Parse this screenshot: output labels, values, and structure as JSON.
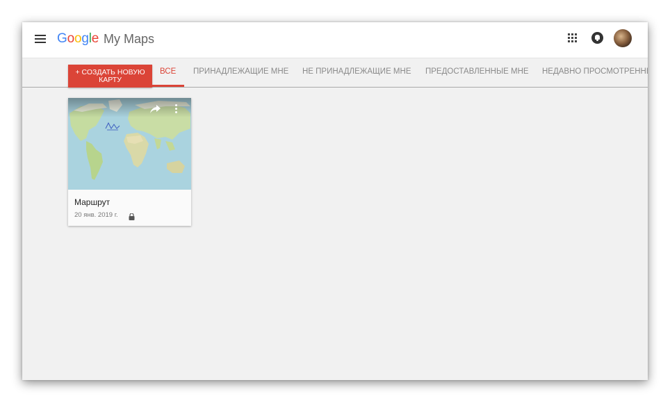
{
  "header": {
    "logo_letters": [
      "G",
      "o",
      "o",
      "g",
      "l",
      "e"
    ],
    "product_name": "My Maps"
  },
  "toolbar": {
    "create_label": "+ СОЗДАТЬ НОВУЮ КАРТУ",
    "tabs": [
      {
        "label": "ВСЕ",
        "active": true
      },
      {
        "label": "ПРИНАДЛЕЖАЩИЕ МНЕ",
        "active": false
      },
      {
        "label": "НЕ ПРИНАДЛЕЖАЩИЕ МНЕ",
        "active": false
      },
      {
        "label": "ПРЕДОСТАВЛЕННЫЕ МНЕ",
        "active": false
      },
      {
        "label": "НЕДАВНО ПРОСМОТРЕННЫЕ",
        "active": false
      }
    ]
  },
  "maps": [
    {
      "title": "Маршрут",
      "date": "20 янв. 2019 г.",
      "privacy_icon": "lock-icon"
    }
  ],
  "colors": {
    "accent": "#db4437",
    "background": "#f1f1f1"
  }
}
